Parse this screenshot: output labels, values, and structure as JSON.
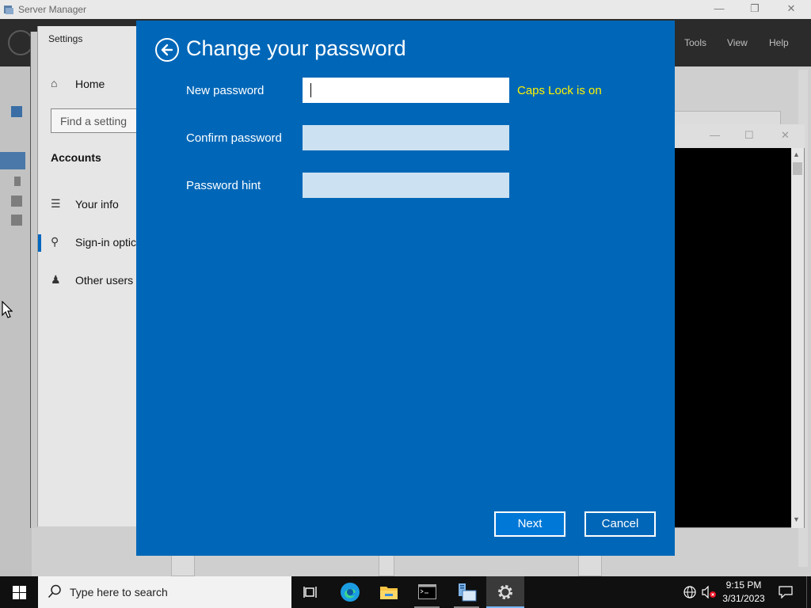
{
  "server_manager": {
    "title": "Server Manager",
    "menu": {
      "tools": "Tools",
      "view": "View",
      "help": "Help"
    }
  },
  "settings": {
    "title": "Settings",
    "home": "Home",
    "search_placeholder": "Find a setting",
    "section": "Accounts",
    "items": [
      {
        "label": "Your info",
        "icon": "person-card-icon"
      },
      {
        "label": "Sign-in optic",
        "icon": "key-icon"
      },
      {
        "label": "Other users",
        "icon": "person-add-icon"
      }
    ]
  },
  "dialog": {
    "title": "Change your password",
    "fields": {
      "new_password": {
        "label": "New password",
        "value": ""
      },
      "confirm_password": {
        "label": "Confirm password",
        "value": ""
      },
      "password_hint": {
        "label": "Password hint",
        "value": ""
      }
    },
    "caps_lock_warning": "Caps Lock is on",
    "next": "Next",
    "cancel": "Cancel",
    "colors": {
      "background": "#0067b8",
      "warning": "#fff200"
    }
  },
  "taskbar": {
    "search_placeholder": "Type here to search",
    "time": "9:15 PM",
    "date": "3/31/2023"
  }
}
